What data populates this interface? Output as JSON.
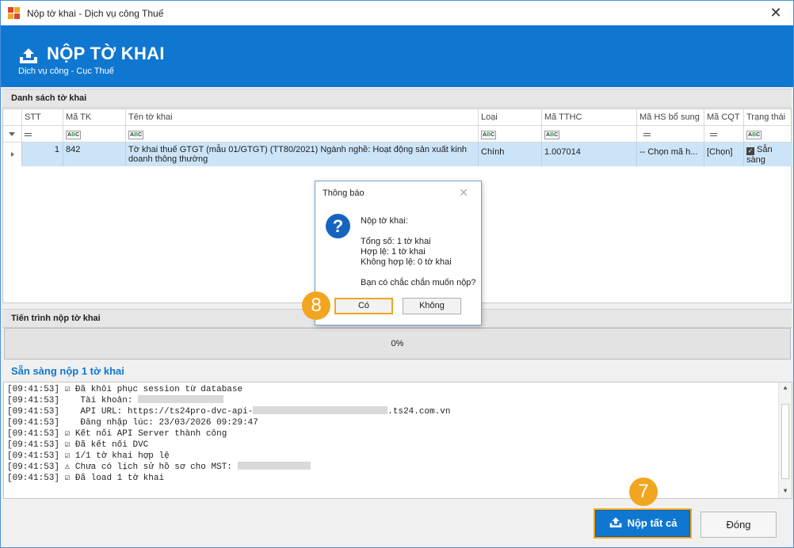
{
  "window": {
    "title": "Nộp tờ khai - Dịch vụ công Thuế",
    "close": "✕"
  },
  "header": {
    "title": "NỘP TỜ KHAI",
    "subtitle": "Dịch vụ công - Cục Thuế",
    "icon": "upload-tray-icon"
  },
  "list_section": {
    "title": "Danh sách tờ khai"
  },
  "grid": {
    "columns": [
      "STT",
      "Mã TK",
      "Tên tờ khai",
      "Loại",
      "Mã TTHC",
      "Mã HS bổ sung",
      "Mã CQT",
      "Trạng thái"
    ],
    "filter_abc": "ABC",
    "rows": [
      {
        "stt": "1",
        "ma_tk": "842",
        "ten_to_khai": "Tờ khai thuế GTGT (mẫu 01/GTGT) (TT80/2021) Ngành nghề: Hoạt động sản xuất kinh",
        "ten_to_khai_2": "doanh thông thường",
        "loai": "Chính",
        "ma_tthc": "1.007014",
        "ma_hs_bo_sung": "-- Chọn mã h...",
        "ma_cqt": "[Chọn]",
        "trang_thai": "Sẵn",
        "trang_thai_2": "sàng"
      }
    ]
  },
  "progress_section": {
    "title": "Tiến trình nộp tờ khai",
    "value": "0%"
  },
  "ready_label": "Sẵn sàng nộp 1 tờ khai",
  "log": {
    "lines": [
      {
        "time": "[09:41:53]",
        "mark": "☑",
        "text": "Đã khôi phục session từ database"
      },
      {
        "time": "[09:41:53]",
        "mark": "",
        "text": "  Tài khoản: "
      },
      {
        "time": "[09:41:53]",
        "mark": "",
        "text": "  API URL: https://ts24pro-dvc-api-",
        "suffix": ".ts24.com.vn"
      },
      {
        "time": "[09:41:53]",
        "mark": "",
        "text": "  Đăng nhập lúc: 23/03/2026 09:29:47"
      },
      {
        "time": "[09:41:53]",
        "mark": "☑",
        "text": "Kết nối API Server thành công"
      },
      {
        "time": "[09:41:53]",
        "mark": "☑",
        "text": "Đã kết nối DVC"
      },
      {
        "time": "[09:41:53]",
        "mark": "☑",
        "text": "1/1 tờ khai hợp lệ"
      },
      {
        "time": "[09:41:53]",
        "mark": "⚠",
        "text": "Chưa có lịch sử hồ sơ cho MST: "
      },
      {
        "time": "[09:41:53]",
        "mark": "☑",
        "text": "Đã load 1 tờ khai"
      }
    ]
  },
  "buttons": {
    "submit_all": "Nộp tất cả",
    "close": "Đóng"
  },
  "badges": {
    "step7": "7",
    "step8": "8"
  },
  "dialog": {
    "title": "Thông báo",
    "close": "✕",
    "icon_glyph": "?",
    "heading": "Nộp tờ khai:",
    "total": "Tổng số: 1 tờ khai",
    "valid": "Hợp lệ: 1 tờ khai",
    "invalid": "Không hợp lệ: 0 tờ khai",
    "question": "Bạn có chắc chắn muốn nộp?",
    "yes": "Có",
    "no": "Không"
  },
  "colors": {
    "accent": "#0f77d0",
    "highlight": "#f2a51f",
    "row_selected": "#cce4f7"
  }
}
